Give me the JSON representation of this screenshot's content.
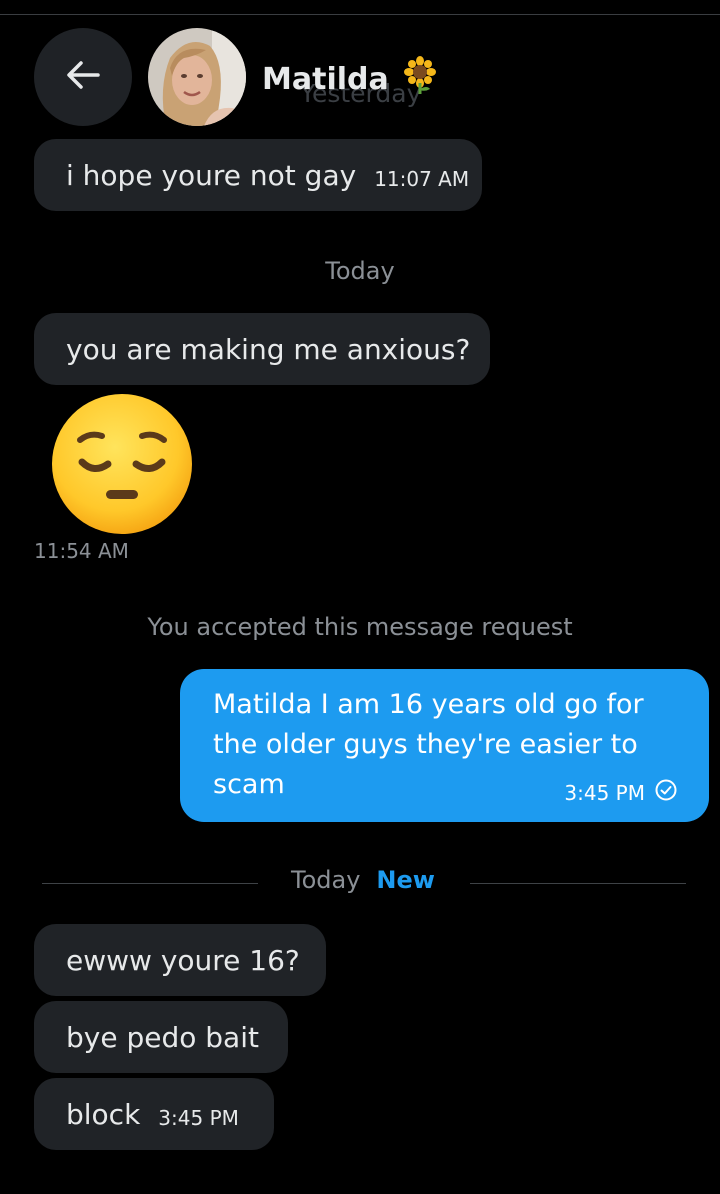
{
  "header": {
    "contact_name": "Matilda",
    "background_day_label": "Yesterday"
  },
  "icons": {
    "back": "arrow-left-icon",
    "name_emoji": "sunflower-icon",
    "read_receipt": "check-circle-icon",
    "sticker": "pensive-face-emoji"
  },
  "colors": {
    "background": "#000000",
    "incoming_bubble": "#202327",
    "outgoing_bubble": "#1d9bf0",
    "accent_new": "#1d9bf0",
    "muted_text": "#8b9096"
  },
  "messages": {
    "m1": {
      "text": "i hope youre not gay",
      "time": "11:07 AM"
    },
    "sep_today": "Today",
    "m2": {
      "text": "you are making me anxious?"
    },
    "m3": {
      "emoji": "😔",
      "time": "11:54 AM"
    },
    "system_note": "You accepted this message request",
    "m4": {
      "text": "Matilda I am 16 years old go for the older guys they're easier to scam",
      "time": "3:45 PM"
    },
    "divider": {
      "label": "Today",
      "new_label": "New"
    },
    "m5": {
      "text": "ewww youre 16?"
    },
    "m6": {
      "text": "bye pedo bait"
    },
    "m7": {
      "text": "block",
      "time": "3:45 PM"
    }
  }
}
